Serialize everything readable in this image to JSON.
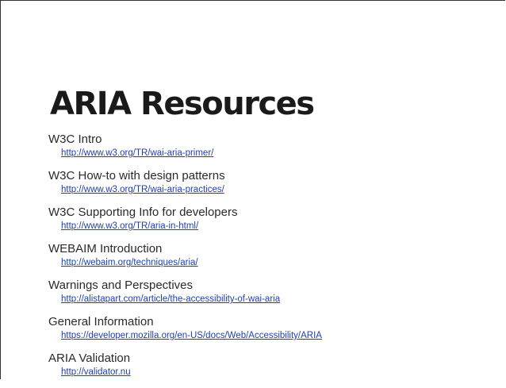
{
  "slide": {
    "title": "ARIA Resources",
    "resources": [
      {
        "label": "W3C Intro",
        "url": "http://www.w3.org/TR/wai-aria-primer/"
      },
      {
        "label": "W3C How-to with design patterns",
        "url": "http://www.w3.org/TR/wai-aria-practices/"
      },
      {
        "label": "W3C Supporting Info for developers",
        "url": "http://www.w3.org/TR/aria-in-html/"
      },
      {
        "label": "WEBAIM Introduction",
        "url": "http://webaim.org/techniques/aria/"
      },
      {
        "label": "Warnings and Perspectives",
        "url": "http://alistapart.com/article/the-accessibility-of-wai-aria"
      },
      {
        "label": "General Information",
        "url": "https://developer.mozilla.org/en-US/docs/Web/Accessibility/ARIA"
      },
      {
        "label": "ARIA Validation",
        "url": "http://validator.nu"
      }
    ]
  },
  "colors": {
    "link": "#1f3fae",
    "text": "#2a2a2a",
    "title": "#1a1a1a",
    "background": "#ffffff"
  }
}
